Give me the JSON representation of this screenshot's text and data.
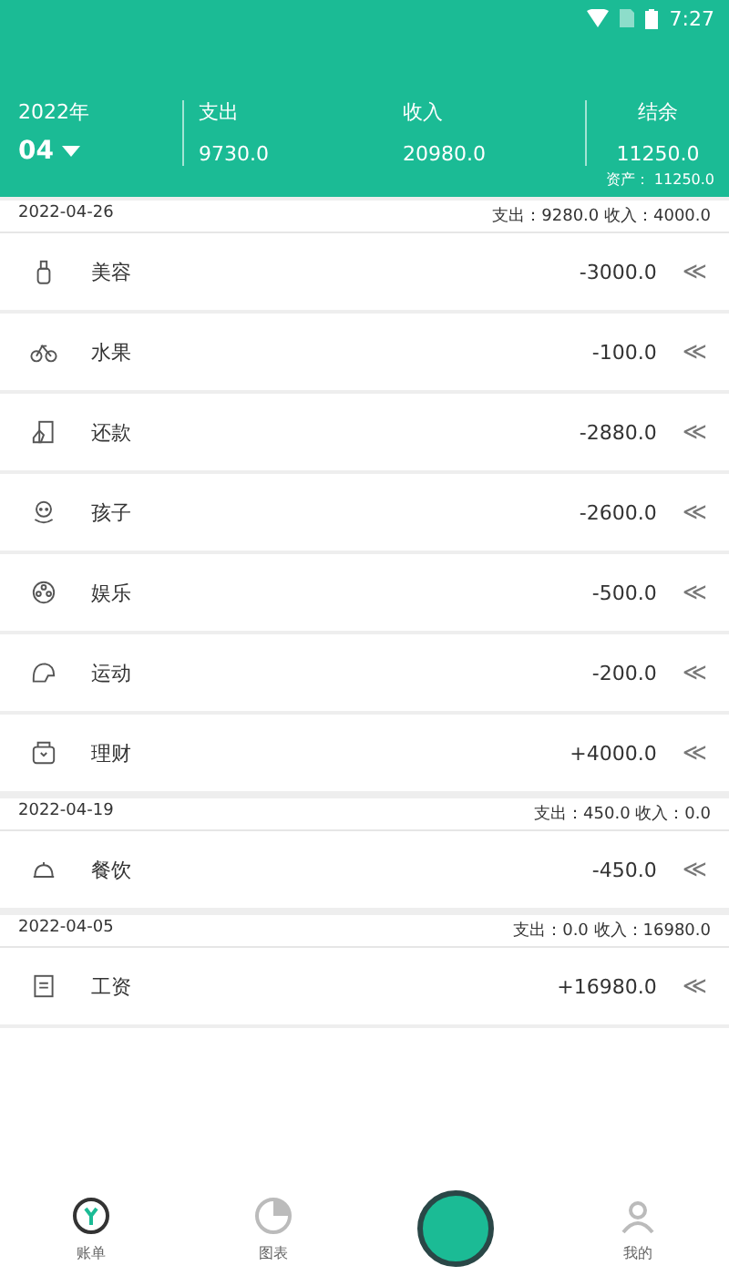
{
  "status_bar": {
    "time": "7:27"
  },
  "header": {
    "year": "2022年",
    "month": "04",
    "columns": [
      {
        "label": "支出",
        "value": "9730.0"
      },
      {
        "label": "收入",
        "value": "20980.0"
      },
      {
        "label": "结余",
        "value": "11250.0"
      }
    ],
    "assets": "资产： 11250.0"
  },
  "groups": [
    {
      "date": "2022-04-26",
      "summary": "支出：9280.0 收入：4000.0",
      "items": [
        {
          "name": "美容",
          "amount": "-3000.0",
          "action": "≪"
        },
        {
          "name": "水果",
          "amount": "-100.0",
          "action": "≪"
        },
        {
          "name": "还款",
          "amount": "-2880.0",
          "action": "≪"
        },
        {
          "name": "孩子",
          "amount": "-2600.0",
          "action": "≪"
        },
        {
          "name": "娱乐",
          "amount": "-500.0",
          "action": "≪"
        },
        {
          "name": "运动",
          "amount": "-200.0",
          "action": "≪"
        },
        {
          "name": "理财",
          "amount": "+4000.0",
          "action": "≪"
        }
      ]
    },
    {
      "date": "2022-04-19",
      "summary": "支出：450.0 收入：0.0",
      "items": [
        {
          "name": "餐饮",
          "amount": "-450.0",
          "action": "≪"
        }
      ]
    },
    {
      "date": "2022-04-05",
      "summary": "支出：0.0 收入：16980.0",
      "items": [
        {
          "name": "工资",
          "amount": "+16980.0",
          "action": "≪"
        }
      ]
    }
  ],
  "bottom_nav": [
    {
      "kind": "tab",
      "label": "账单",
      "selected": true
    },
    {
      "kind": "tab",
      "label": "图表",
      "selected": false
    },
    {
      "kind": "add"
    },
    {
      "kind": "tab",
      "label": "我的",
      "selected": false
    }
  ]
}
